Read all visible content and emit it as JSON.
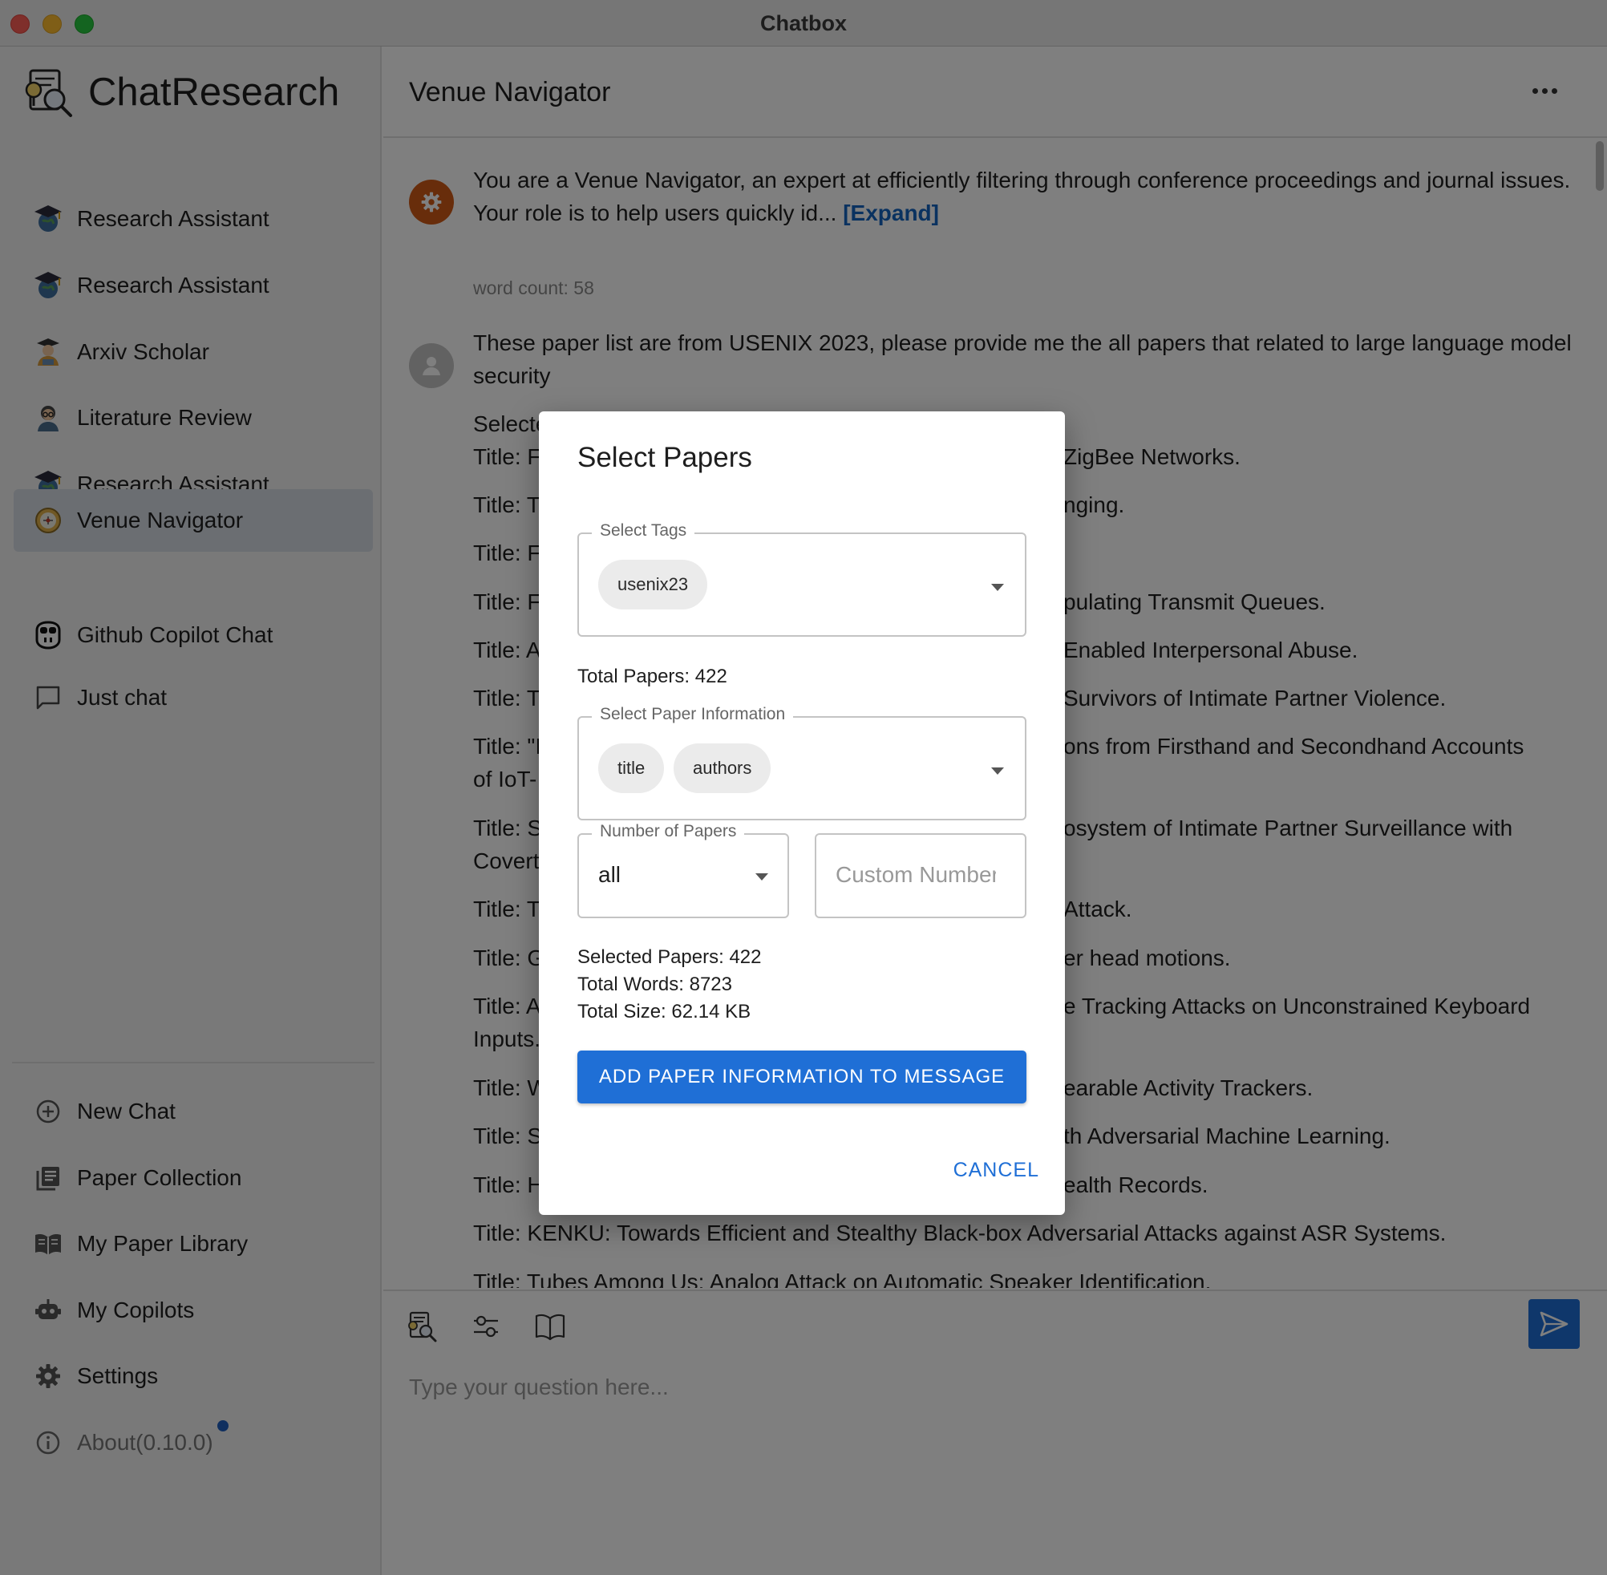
{
  "window": {
    "title": "Chatbox"
  },
  "sidebar": {
    "brand": "ChatResearch",
    "items": [
      {
        "label": "Research Assistant",
        "icon": "graduation-globe-icon"
      },
      {
        "label": "Research Assistant",
        "icon": "graduation-globe-icon"
      },
      {
        "label": "Arxiv Scholar",
        "icon": "scholar-avatar-icon"
      },
      {
        "label": "Literature Review",
        "icon": "reviewer-avatar-icon"
      },
      {
        "label": "Research Assistant",
        "icon": "graduation-globe-icon"
      },
      {
        "label": "Venue Navigator",
        "icon": "compass-icon",
        "active": true
      },
      {
        "label": "Github Copilot Chat",
        "icon": "copilot-icon"
      },
      {
        "label": "Just chat",
        "icon": "chat-bubble-icon"
      }
    ],
    "bottom_items": [
      {
        "label": "New Chat",
        "icon": "plus-circle-icon"
      },
      {
        "label": "Paper Collection",
        "icon": "collection-icon"
      },
      {
        "label": "My Paper Library",
        "icon": "book-open-icon"
      },
      {
        "label": "My Copilots",
        "icon": "robot-icon"
      },
      {
        "label": "Settings",
        "icon": "gear-icon"
      },
      {
        "label": "About(0.10.0)",
        "icon": "info-icon",
        "badge": true
      }
    ]
  },
  "main": {
    "title": "Venue Navigator",
    "system_message": {
      "text": "You are a Venue Navigator, an expert at efficiently filtering through conference proceedings and journal issues. Your role is to help users quickly id...",
      "expand_label": "[Expand]",
      "word_count": "word count: 58"
    },
    "user_message": {
      "text": "These paper list are from USENIX 2023, please provide me the all papers that related to large language model security"
    },
    "paper_lines": [
      "Selecte",
      "Title: F",
      "Title: T",
      "Title: F",
      "Title: F",
      "Title: A",
      "Title: T",
      "Title: \"I",
      "of IoT-",
      "Title: S",
      "Covert",
      "Title: T",
      "Title: G",
      "Title: A",
      "Inputs.",
      "Title: W",
      "Title: S",
      "Title: H",
      "Title: KENKU: Towards Efficient and Stealthy Black-box Adversarial Attacks against ASR Systems.",
      "Title: Tubes Among Us: Analog Attack on Automatic Speaker Identification."
    ],
    "paper_line_tails": [
      "ZigBee Networks.",
      "nging.",
      "pulating Transmit Queues.",
      "Enabled Interpersonal Abuse.",
      "Survivors of Intimate Partner Violence.",
      "ons from Firsthand and Secondhand Accounts",
      "osystem of Intimate Partner Surveillance with",
      "Attack.",
      "er head motions.",
      "e Tracking Attacks on Unconstrained Keyboard",
      "earable Activity Trackers.",
      "th Adversarial Machine Learning.",
      "ealth Records."
    ],
    "composer": {
      "placeholder": "Type your question here...",
      "tools": [
        "research-icon",
        "sliders-icon",
        "book-icon"
      ]
    }
  },
  "dialog": {
    "title": "Select Papers",
    "tags_label": "Select Tags",
    "tags": [
      "usenix23"
    ],
    "total_papers": "Total Papers: 422",
    "info_label": "Select Paper Information",
    "info_fields": [
      "title",
      "authors"
    ],
    "number_label": "Number of Papers",
    "number_value": "all",
    "custom_placeholder": "Custom Number",
    "selected_papers": "Selected Papers: 422",
    "total_words": "Total Words: 8723",
    "total_size": "Total Size: 62.14 KB",
    "add_button": "ADD PAPER INFORMATION TO MESSAGE",
    "cancel_button": "CANCEL"
  },
  "colors": {
    "accent": "#1f6fd6",
    "active_nav": "#d6dde4",
    "system_avatar": "#d15b16",
    "overlay": "rgba(0,0,0,0.5)"
  }
}
